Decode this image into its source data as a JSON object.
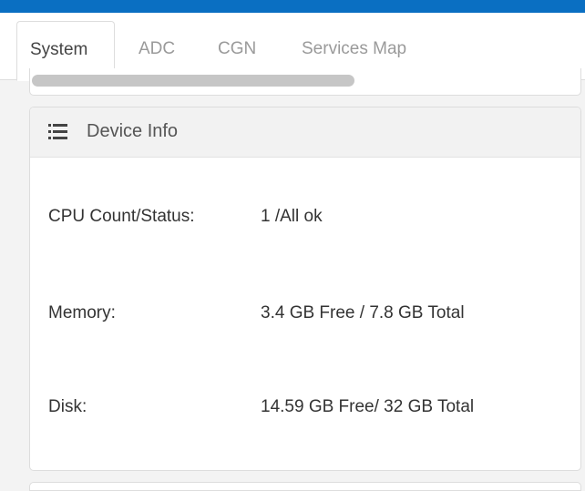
{
  "tabs": [
    {
      "label": "System",
      "active": true
    },
    {
      "label": "ADC",
      "active": false
    },
    {
      "label": "CGN",
      "active": false
    },
    {
      "label": "Services Map",
      "active": false
    }
  ],
  "device_info": {
    "title": "Device Info",
    "icon": "list-icon",
    "rows": [
      {
        "label": "CPU Count/Status:",
        "value": "1 /All ok"
      },
      {
        "label": "Memory:",
        "value": "3.4 GB Free / 7.8 GB Total"
      },
      {
        "label": "Disk:",
        "value": "14.59 GB Free/ 32 GB Total"
      }
    ]
  },
  "colors": {
    "top_bar": "#0a6fc2",
    "panel_header": "#f2f2f2",
    "border": "#dddddd"
  }
}
